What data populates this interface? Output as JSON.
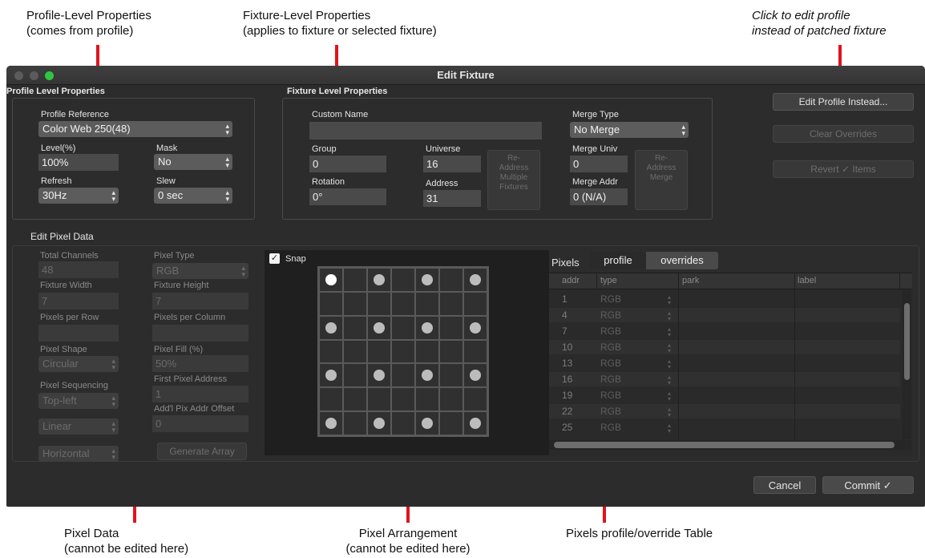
{
  "annotations": {
    "profile_level": [
      "Profile-Level Properties",
      "(comes from profile)"
    ],
    "fixture_level": [
      "Fixture-Level Properties",
      "(applies to fixture or selected fixture)"
    ],
    "edit_profile": [
      "Click to edit profile",
      "instead of patched fixture"
    ],
    "pixel_data": [
      "Pixel Data",
      "(cannot be edited here)"
    ],
    "pixel_arrangement": [
      "Pixel Arrangement",
      "(cannot be edited here)"
    ],
    "pixels_table": [
      "Pixels profile/override Table"
    ]
  },
  "window": {
    "title": "Edit Fixture",
    "traffic_lights": [
      "#5b5b5b",
      "#5b5b5b",
      "#2ec840"
    ]
  },
  "profile_props": {
    "section_title": "Profile Level Properties",
    "profile_reference_label": "Profile Reference",
    "profile_reference_value": "Color Web 250(48)",
    "level_label": "Level(%)",
    "level_value": "100%",
    "mask_label": "Mask",
    "mask_value": "No",
    "refresh_label": "Refresh",
    "refresh_value": "30Hz",
    "slew_label": "Slew",
    "slew_value": "0 sec"
  },
  "fixture_props": {
    "section_title": "Fixture Level Properties",
    "custom_name_label": "Custom Name",
    "custom_name_value": "",
    "merge_type_label": "Merge Type",
    "merge_type_value": "No Merge",
    "group_label": "Group",
    "group_value": "0",
    "universe_label": "Universe",
    "universe_value": "16",
    "readdress_multiple": [
      "Re-",
      "Address",
      "Multiple",
      "Fixtures"
    ],
    "merge_univ_label": "Merge Univ",
    "merge_univ_value": "0",
    "readdress_merge": [
      "Re-",
      "Address",
      "Merge"
    ],
    "rotation_label": "Rotation",
    "rotation_value": "0°",
    "address_label": "Address",
    "address_value": "31",
    "merge_addr_label": "Merge Addr",
    "merge_addr_value": "0 (N/A)"
  },
  "side_buttons": {
    "edit_profile": "Edit Profile Instead...",
    "clear_overrides": "Clear Overrides",
    "revert_items": "Revert ✓ Items"
  },
  "pixel_data": {
    "section_title": "Edit Pixel Data",
    "total_channels_label": "Total Channels",
    "total_channels_value": "48",
    "pixel_type_label": "Pixel Type",
    "pixel_type_value": "RGB",
    "fixture_width_label": "Fixture Width",
    "fixture_width_value": "7",
    "fixture_height_label": "Fixture Height",
    "fixture_height_value": "7",
    "pixels_per_row_label": "Pixels per Row",
    "pixels_per_row_value": "",
    "pixels_per_column_label": "Pixels per Column",
    "pixels_per_column_value": "",
    "pixel_shape_label": "Pixel Shape",
    "pixel_shape_value": "Circular",
    "pixel_fill_label": "Pixel Fill (%)",
    "pixel_fill_value": "50%",
    "first_pixel_address_label": "First Pixel Address",
    "first_pixel_address_value": "1",
    "pixel_sequencing_label": "Pixel Sequencing",
    "pixel_sequencing_value": "Top-left",
    "addl_offset_label": "Add'l Pix Addr Offset",
    "addl_offset_value": "0",
    "sequencing_mode_value": "Linear",
    "orientation_value": "Horizontal",
    "generate_array_label": "Generate Array"
  },
  "grid": {
    "snap_label": "Snap",
    "snap_checked": true,
    "columns": 7,
    "rows": 7
  },
  "pixels_table": {
    "label": "Pixels",
    "tab_profile": "profile",
    "tab_overrides": "overrides",
    "columns": [
      "addr",
      "type",
      "park",
      "label"
    ],
    "rows": [
      {
        "addr": "1",
        "type": "RGB"
      },
      {
        "addr": "4",
        "type": "RGB"
      },
      {
        "addr": "7",
        "type": "RGB"
      },
      {
        "addr": "10",
        "type": "RGB"
      },
      {
        "addr": "13",
        "type": "RGB"
      },
      {
        "addr": "16",
        "type": "RGB"
      },
      {
        "addr": "19",
        "type": "RGB"
      },
      {
        "addr": "22",
        "type": "RGB"
      },
      {
        "addr": "25",
        "type": "RGB"
      }
    ]
  },
  "footer": {
    "cancel": "Cancel",
    "commit": "Commit ✓"
  }
}
